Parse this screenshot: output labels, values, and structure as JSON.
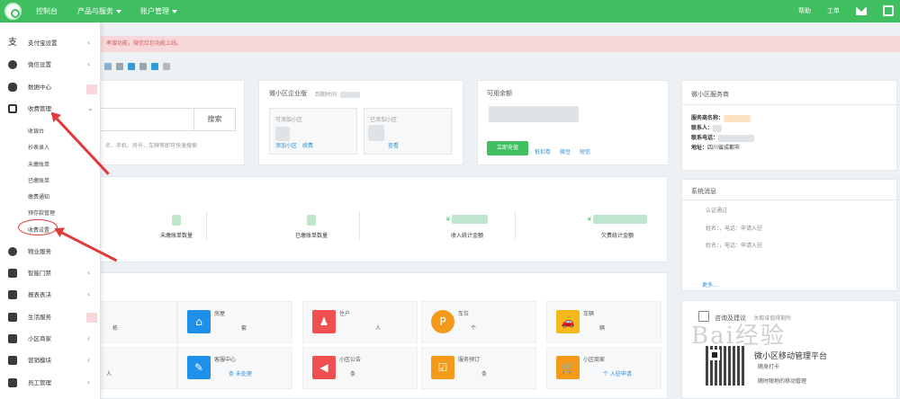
{
  "topbar": {
    "nav": [
      {
        "label": "控制台"
      },
      {
        "label": "产品与服务",
        "dropdown": true
      },
      {
        "label": "账户管理",
        "dropdown": true
      }
    ],
    "help": "帮助",
    "ticket": "工单"
  },
  "alert": {
    "text": "率增功能，微信红包功能上线。"
  },
  "search": {
    "button": "搜索",
    "hint": "名、手机、房号、车牌等即可快速搜索"
  },
  "plan": {
    "title": "微小区企业版",
    "expire_label": "到期时间:",
    "box1_label": "可添加小区",
    "box1_links": [
      "添加小区",
      "续费"
    ],
    "box2_label": "已添加小区",
    "box2_link": "查看"
  },
  "balance": {
    "title": "可用余额",
    "recharge": "立即充值",
    "links": [
      "抵扣卷",
      "微豆",
      "短信"
    ]
  },
  "service": {
    "title": "微小区服务商",
    "rows": [
      {
        "k": "服务商名称：",
        "v": ""
      },
      {
        "k": "联系人：",
        "v": ""
      },
      {
        "k": "联系电话：",
        "v": ""
      },
      {
        "k": "地址：",
        "v": "四川省成都市"
      }
    ]
  },
  "stats": [
    {
      "label": "未缴账单数量",
      "value": ""
    },
    {
      "label": "已缴账单数量",
      "value": ""
    },
    {
      "label": "收入统计金额",
      "value": "¥"
    },
    {
      "label": "欠费统计金额",
      "value": "¥"
    }
  ],
  "sys": {
    "title": "系统消息",
    "items": [
      "认证通过",
      "姓名：，电话：申请入驻",
      "姓名：，电话：申请入驻"
    ],
    "more": "更多..."
  },
  "tiles": [
    {
      "label": "",
      "value": "栋",
      "icon": "building-icon",
      "color": "#1e90e8"
    },
    {
      "label": "房屋",
      "value": "套",
      "icon": "home-icon",
      "color": "#1e90e8"
    },
    {
      "label": "住户",
      "value": "人",
      "icon": "user-icon",
      "color": "#ef4f4f"
    },
    {
      "label": "车位",
      "value": "个",
      "icon": "parking-icon",
      "color": "#f49a1a"
    },
    {
      "label": "车辆",
      "value": "辆",
      "icon": "car-icon",
      "color": "#f6b91c"
    },
    {
      "label": "",
      "value": "人",
      "icon": "staff-icon",
      "color": "#1e90e8"
    },
    {
      "label": "客服中心",
      "value": "条 未处理",
      "icon": "wrench-icon",
      "color": "#1e90e8"
    },
    {
      "label": "小区公告",
      "value": "条",
      "icon": "megaphone-icon",
      "color": "#ef4f4f"
    },
    {
      "label": "服务预订",
      "value": "条",
      "icon": "calendar-icon",
      "color": "#f49a1a"
    },
    {
      "label": "小区商家",
      "value": "个 入驻申请",
      "icon": "cart-icon",
      "color": "#f49a1a"
    }
  ],
  "contact": {
    "title": "咨询及建议",
    "hint": "关都谁值得期所",
    "app": "微小区移动管理平台",
    "tip": "随身打卡",
    "sub": "随时随地的移动管理"
  },
  "watermark": "Bai经验",
  "sidebar": {
    "items": [
      {
        "label": "支付宝设置",
        "icon": "alipay-icon",
        "arrow": "‹"
      },
      {
        "label": "微信设置",
        "icon": "wechat-icon",
        "arrow": "‹"
      },
      {
        "label": "数据中心",
        "icon": "database-icon",
        "arrow": ""
      },
      {
        "label": "收费管理",
        "icon": "fee-icon",
        "arrow": "⌄"
      },
      {
        "label": "物业服务",
        "icon": "service-icon",
        "arrow": ""
      },
      {
        "label": "智能门禁",
        "icon": "lock-icon",
        "arrow": "‹"
      },
      {
        "label": "报表表决",
        "icon": "chart-icon",
        "arrow": "‹"
      },
      {
        "label": "生活服务",
        "icon": "bank-icon",
        "arrow": ""
      },
      {
        "label": "小区商家",
        "icon": "cart-icon",
        "arrow": "‹"
      },
      {
        "label": "营销模块",
        "icon": "magic-icon",
        "arrow": "‹"
      },
      {
        "label": "员工管理",
        "icon": "staff-icon",
        "arrow": "‹"
      }
    ],
    "subitems": [
      "收银台",
      "抄表录入",
      "未缴账单",
      "已缴账单",
      "缴费通知",
      "预存款管理",
      "收费设置"
    ]
  }
}
